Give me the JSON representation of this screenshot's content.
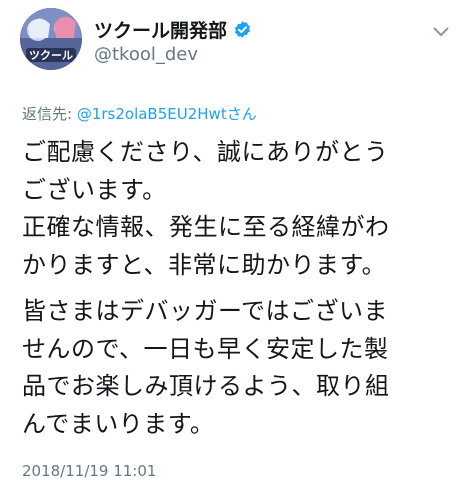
{
  "author": {
    "display_name": "ツクール開発部",
    "handle": "@tkool_dev",
    "verified_icon": "verified-badge-icon",
    "avatar_text": "ツクール"
  },
  "reply": {
    "prefix": "返信先: ",
    "target": "@1rs2olaB5EU2Hwtさん"
  },
  "body": {
    "paragraphs": [
      {
        "lines": [
          "ご配慮くださり、誠にありがとう",
          "ございます。",
          "正確な情報、発生に至る経緯がわ",
          "かりますと、非常に助かります。"
        ]
      },
      {
        "lines": [
          "皆さまはデバッガーではございま",
          "せんので、一日も早く安定した製",
          "品でお楽しみ頂けるよう、取り組",
          "んでまいります。"
        ]
      }
    ]
  },
  "timestamp": "2018/11/19 11:01",
  "menu_icon": "chevron-down-icon",
  "colors": {
    "text": "#14171a",
    "secondary": "#657786",
    "link": "#1da1f2",
    "verified": "#1da1f2"
  }
}
